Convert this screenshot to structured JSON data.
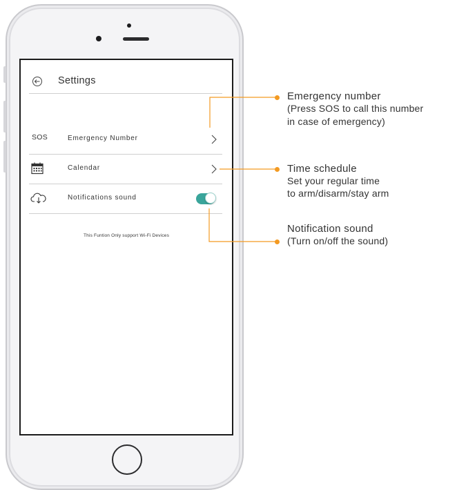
{
  "settings": {
    "title": "Settings",
    "rows": [
      {
        "prefix": "SOS",
        "label": "Emergency Number"
      },
      {
        "label": "Calendar",
        "icon": "calendar-icon"
      },
      {
        "label": "Notifications sound",
        "icon": "cloud-download-icon",
        "toggle_on": true
      }
    ],
    "note": "This Funtion Only support Wi-Fi Devices"
  },
  "callouts": {
    "emergency": {
      "title": "Emergency number",
      "line1": "(Press SOS to call this number",
      "line2": "in case of emergency)"
    },
    "schedule": {
      "title": "Time schedule",
      "line1": "Set your regular time",
      "line2": "to arm/disarm/stay arm"
    },
    "notification": {
      "title": "Notification sound",
      "line1": "(Turn on/off the sound)"
    }
  },
  "colors": {
    "accent": "#f39a22",
    "toggle": "#3aa59b"
  }
}
